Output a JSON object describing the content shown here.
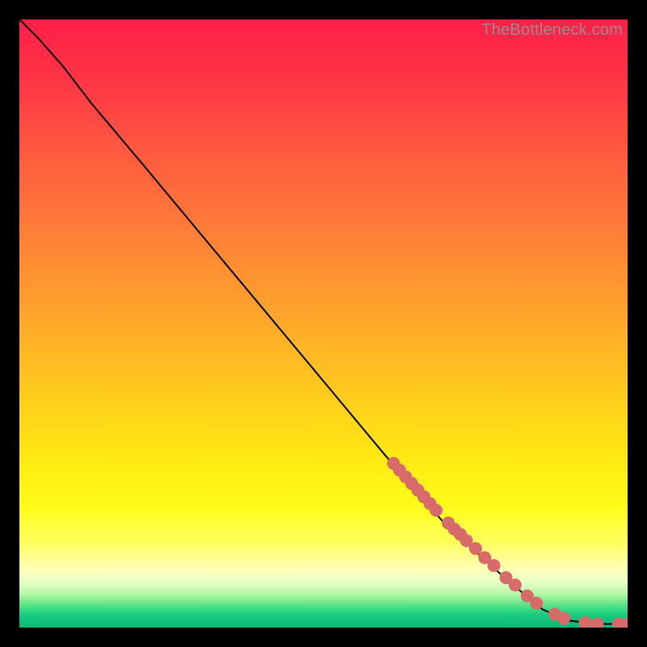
{
  "watermark": "TheBottleneck.com",
  "chart_data": {
    "type": "line",
    "title": "",
    "xlabel": "",
    "ylabel": "",
    "xlim": [
      0,
      100
    ],
    "ylim": [
      0,
      100
    ],
    "grid": false,
    "legend": false,
    "curve": [
      {
        "x": 0,
        "y": 100
      },
      {
        "x": 3,
        "y": 97
      },
      {
        "x": 7,
        "y": 92.5
      },
      {
        "x": 12,
        "y": 86
      },
      {
        "x": 20,
        "y": 76.5
      },
      {
        "x": 30,
        "y": 64.5
      },
      {
        "x": 40,
        "y": 52.5
      },
      {
        "x": 50,
        "y": 40.5
      },
      {
        "x": 60,
        "y": 28.5
      },
      {
        "x": 70,
        "y": 17
      },
      {
        "x": 80,
        "y": 8
      },
      {
        "x": 86,
        "y": 3
      },
      {
        "x": 90,
        "y": 1.2
      },
      {
        "x": 95,
        "y": 0.6
      },
      {
        "x": 100,
        "y": 0.6
      }
    ],
    "markers": [
      {
        "x": 61.5,
        "y": 27.0
      },
      {
        "x": 62.5,
        "y": 25.9
      },
      {
        "x": 63.5,
        "y": 24.8
      },
      {
        "x": 64.5,
        "y": 23.7
      },
      {
        "x": 65.5,
        "y": 22.6
      },
      {
        "x": 66.5,
        "y": 21.5
      },
      {
        "x": 67.5,
        "y": 20.4
      },
      {
        "x": 68.5,
        "y": 19.3
      },
      {
        "x": 70.5,
        "y": 17.2
      },
      {
        "x": 71.5,
        "y": 16.2
      },
      {
        "x": 72.5,
        "y": 15.3
      },
      {
        "x": 73.5,
        "y": 14.3
      },
      {
        "x": 75.0,
        "y": 13.0
      },
      {
        "x": 76.5,
        "y": 11.5
      },
      {
        "x": 78.0,
        "y": 10.2
      },
      {
        "x": 80.0,
        "y": 8.2
      },
      {
        "x": 81.5,
        "y": 7.0
      },
      {
        "x": 83.5,
        "y": 5.2
      },
      {
        "x": 85.0,
        "y": 4.0
      },
      {
        "x": 88.0,
        "y": 2.2
      },
      {
        "x": 89.5,
        "y": 1.5
      },
      {
        "x": 93.0,
        "y": 0.8
      },
      {
        "x": 95.0,
        "y": 0.6
      },
      {
        "x": 98.5,
        "y": 0.6
      },
      {
        "x": 100.0,
        "y": 0.6
      }
    ],
    "marker_color": "#d96a6a",
    "gradient_stops": [
      {
        "offset": 0.0,
        "color": "#ff1f48"
      },
      {
        "offset": 0.1,
        "color": "#ff3546"
      },
      {
        "offset": 0.22,
        "color": "#ff5a3f"
      },
      {
        "offset": 0.35,
        "color": "#ff7e38"
      },
      {
        "offset": 0.48,
        "color": "#ffa32c"
      },
      {
        "offset": 0.6,
        "color": "#ffc71f"
      },
      {
        "offset": 0.72,
        "color": "#ffe913"
      },
      {
        "offset": 0.8,
        "color": "#fffb18"
      },
      {
        "offset": 0.86,
        "color": "#ffff5e"
      },
      {
        "offset": 0.905,
        "color": "#ffffba"
      },
      {
        "offset": 0.925,
        "color": "#e9ffc4"
      },
      {
        "offset": 0.945,
        "color": "#b3f7a8"
      },
      {
        "offset": 0.96,
        "color": "#6be58a"
      },
      {
        "offset": 0.972,
        "color": "#2fd884"
      },
      {
        "offset": 0.982,
        "color": "#14c87d"
      },
      {
        "offset": 1.0,
        "color": "#0db876"
      }
    ]
  }
}
